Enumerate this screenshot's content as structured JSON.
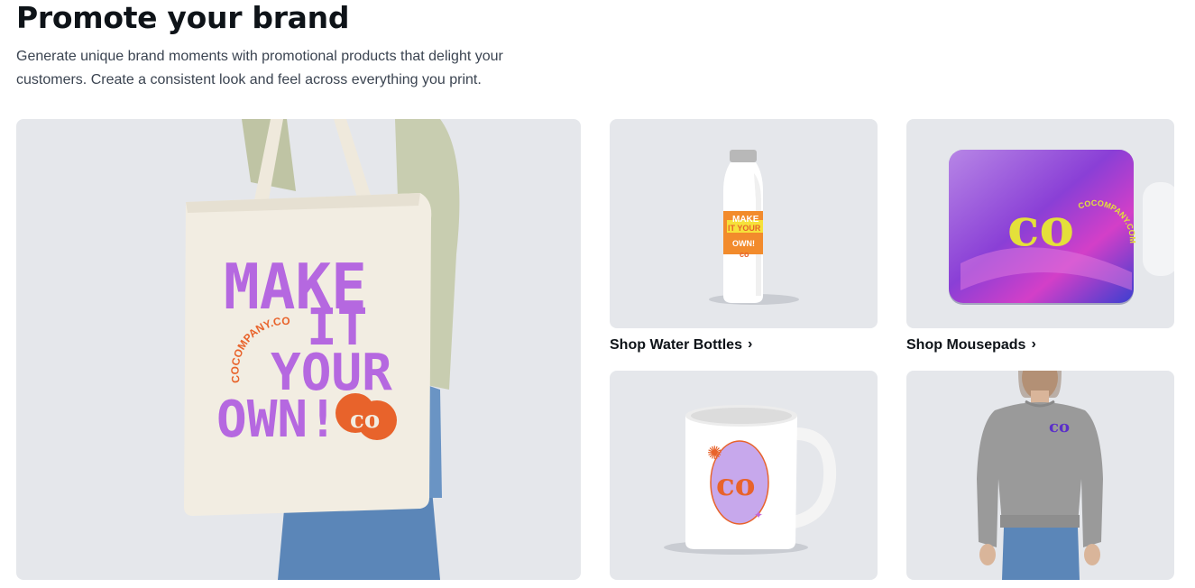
{
  "header": {
    "title": "Promote your brand",
    "subtitle": "Generate unique brand moments with promotional products that delight your customers. Create a consistent look and feel across everything you print."
  },
  "tiles": {
    "hero": {
      "tote_line1": "MAKE",
      "tote_line2": "IT",
      "tote_line3": "YOUR",
      "tote_line4": "OWN!",
      "tote_site": "COCOMPANY.COM"
    },
    "bottle": {
      "label1": "MAKE",
      "label2": "IT YOUR",
      "label3": "OWN!",
      "caption": "Shop Water Bottles"
    },
    "mousepad": {
      "site": "COCOMPANY.COM",
      "caption": "Shop Mousepads"
    },
    "mug": {},
    "sweatshirt": {}
  },
  "icons": {
    "chevron": "›"
  },
  "colors": {
    "tile_bg": "#e5e7eb",
    "purple": "#b568e0",
    "orange": "#e8632b",
    "brand_yellow": "#e4e03a"
  }
}
